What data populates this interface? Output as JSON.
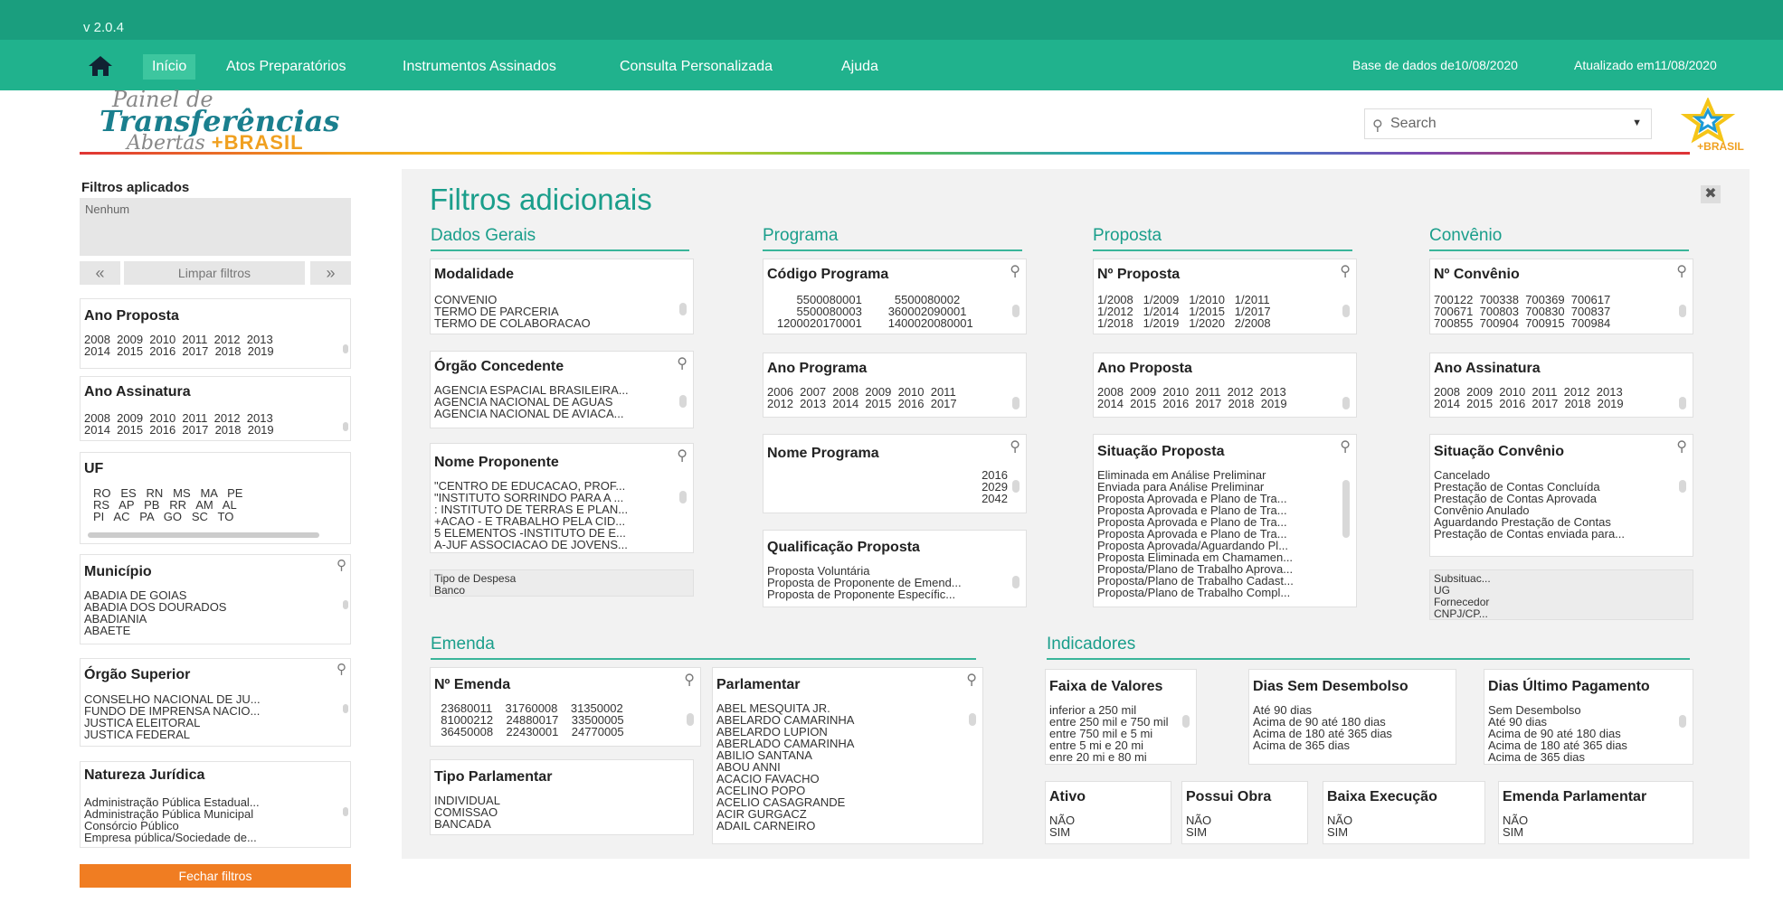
{
  "app": {
    "version": "v 2.0.4",
    "nav": [
      "Início",
      "Atos Preparatórios",
      "Instrumentos Assinados",
      "Consulta Personalizada",
      "Ajuda"
    ],
    "db_date_label": "Base de dados de10/08/2020",
    "updated_label": "Atualizado em11/08/2020",
    "logo": {
      "line1": "Painel de",
      "line2": "Transferências",
      "line3": "Abertas",
      "line3b": "+BRASIL"
    },
    "search_placeholder": "Search",
    "star_logo_text": "+BRASIL"
  },
  "sidebar": {
    "applied_title": "Filtros aplicados",
    "applied_value": "Nenhum",
    "prev": "«",
    "clear": "Limpar filtros",
    "next": "»",
    "ano_proposta": {
      "title": "Ano Proposta",
      "rows": "2008  2009  2010  2011  2012  2013\n2014  2015  2016  2017  2018  2019"
    },
    "ano_assinatura": {
      "title": "Ano Assinatura",
      "rows": "2008  2009  2010  2011  2012  2013\n2014  2015  2016  2017  2018  2019"
    },
    "uf": {
      "title": "UF",
      "rows": "RO   ES   RN   MS   MA   PE\nRS   AP   PB   RR   AM   AL\nPI   AC   PA   GO   SC   TO"
    },
    "municipio": {
      "title": "Município",
      "rows": "ABADIA DE GOIAS\nABADIA DOS DOURADOS\nABADIANIA\nABAETE"
    },
    "orgao_superior": {
      "title": "Órgão Superior",
      "rows": "CONSELHO NACIONAL DE JU...\nFUNDO DE IMPRENSA NACIO...\nJUSTICA ELEITORAL\nJUSTICA FEDERAL"
    },
    "natureza": {
      "title": "Natureza Jurídica",
      "rows": "Administração Pública Estadual...\nAdministração Pública Municipal\nConsórcio Público\nEmpresa pública/Sociedade de..."
    },
    "close_button": "Fechar filtros"
  },
  "main": {
    "title": "Filtros adicionais",
    "close": "✖",
    "sections": {
      "dados_gerais": "Dados Gerais",
      "programa": "Programa",
      "proposta": "Proposta",
      "convenio": "Convênio",
      "emenda": "Emenda",
      "indicadores": "Indicadores"
    },
    "boxes": {
      "modalidade": {
        "title": "Modalidade",
        "rows": "CONVENIO\nTERMO DE PARCERIA\nTERMO DE COLABORACAO"
      },
      "orgao_concedente": {
        "title": "Órgão Concedente",
        "rows": "AGENCIA ESPACIAL BRASILEIRA...\nAGENCIA NACIONAL DE AGUAS\nAGENCIA NACIONAL DE AVIACA..."
      },
      "nome_proponente": {
        "title": "Nome Proponente",
        "rows": "\"CENTRO DE EDUCACAO, PROF...\n\"INSTITUTO SORRINDO PARA A ...\n: INSTITUTO DE TERRAS E PLAN...\n+ACAO - E TRABALHO PELA CID...\n5 ELEMENTOS -INSTITUTO DE E...\nA-JUF ASSOCIACAO DE JOVENS..."
      },
      "tipo_despesa": {
        "rows": "Tipo de Despesa\nBanco"
      },
      "codigo_programa": {
        "title": "Código Programa",
        "rows": "         5500080001          5500080002\n         5500080003        360002090001\n   1200020170001        1400020080001"
      },
      "ano_programa": {
        "title": "Ano Programa",
        "rows": "2006  2007  2008  2009  2010  2011\n2012  2013  2014  2015  2016  2017"
      },
      "nome_programa": {
        "title": "Nome Programa",
        "rows": "2016\n2029\n2042"
      },
      "qualificacao": {
        "title": "Qualificação Proposta",
        "rows": "Proposta Voluntária\nProposta de Proponente de Emend...\nProposta de Proponente Específic..."
      },
      "num_proposta": {
        "title": "Nº Proposta",
        "rows": "1/2008   1/2009   1/2010   1/2011\n1/2012   1/2014   1/2015   1/2017\n1/2018   1/2019   1/2020   2/2008"
      },
      "ano_proposta": {
        "title": "Ano Proposta",
        "rows": "2008  2009  2010  2011  2012  2013\n2014  2015  2016  2017  2018  2019"
      },
      "situacao_proposta": {
        "title": "Situação Proposta",
        "rows": "Eliminada em Análise Preliminar\nEnviada para Análise Preliminar\nProposta Aprovada e Plano de Tra...\nProposta Aprovada e Plano de Tra...\nProposta Aprovada e Plano de Tra...\nProposta Aprovada e Plano de Tra...\nProposta Aprovada/Aguardando Pl...\nProposta Eliminada em Chamamen...\nProposta/Plano de Trabalho Aprova...\nProposta/Plano de Trabalho Cadast...\nProposta/Plano de Trabalho Compl..."
      },
      "num_convenio": {
        "title": "Nº Convênio",
        "rows": "700122  700338  700369  700617\n700671  700803  700830  700837\n700855  700904  700915  700984"
      },
      "ano_assinatura": {
        "title": "Ano Assinatura",
        "rows": "2008  2009  2010  2011  2012  2013\n2014  2015  2016  2017  2018  2019"
      },
      "situacao_convenio": {
        "title": "Situação Convênio",
        "rows": "Cancelado\nPrestação de Contas Concluída\nPrestação de Contas Aprovada\nConvênio Anulado\nAguardando Prestação de Contas\nPrestação de Contas enviada para..."
      },
      "subsituacao": {
        "rows": "Subsituac...\nUG\nFornecedor\nCNPJ/CP..."
      },
      "num_emenda": {
        "title": "Nº Emenda",
        "rows": "  23680011    31760008    31350002\n  81000212    24880017    33500005\n  36450008    22430001    24770005"
      },
      "tipo_parlamentar": {
        "title": "Tipo Parlamentar",
        "rows": "INDIVIDUAL\nCOMISSAO\nBANCADA"
      },
      "parlamentar": {
        "title": "Parlamentar",
        "rows": "ABEL MESQUITA JR.\nABELARDO CAMARINHA\nABELARDO LUPION\nABERLADO CAMARINHA\nABILIO SANTANA\nABOU ANNI\nACACIO FAVACHO\nACELINO POPO\nACELIO CASAGRANDE\nACIR GURGACZ\nADAIL CARNEIRO"
      },
      "faixa_valores": {
        "title": "Faixa de Valores",
        "rows": "inferior a 250 mil\nentre 250 mil e 750 mil\nentre 750 mil e 5 mi\nentre 5 mi e 20 mi\nenre 20 mi e 80 mi"
      },
      "dias_sem_desembolso": {
        "title": "Dias Sem Desembolso",
        "rows": "Até 90 dias\nAcima de 90 até 180 dias\nAcima de 180 até 365 dias\nAcima de 365 dias"
      },
      "dias_ultimo_pagamento": {
        "title": "Dias Último Pagamento",
        "rows": "Sem Desembolso\nAté 90 dias\nAcima de 90 até 180 dias\nAcima de 180 até 365 dias\nAcima de 365 dias"
      },
      "ativo": {
        "title": "Ativo",
        "rows": "NÃO\nSIM"
      },
      "possui_obra": {
        "title": "Possui Obra",
        "rows": "NÃO\nSIM"
      },
      "baixa_execucao": {
        "title": "Baixa Execução",
        "rows": "NÃO\nSIM"
      },
      "emenda_parlamentar": {
        "title": "Emenda Parlamentar",
        "rows": "NÃO\nSIM"
      }
    }
  }
}
